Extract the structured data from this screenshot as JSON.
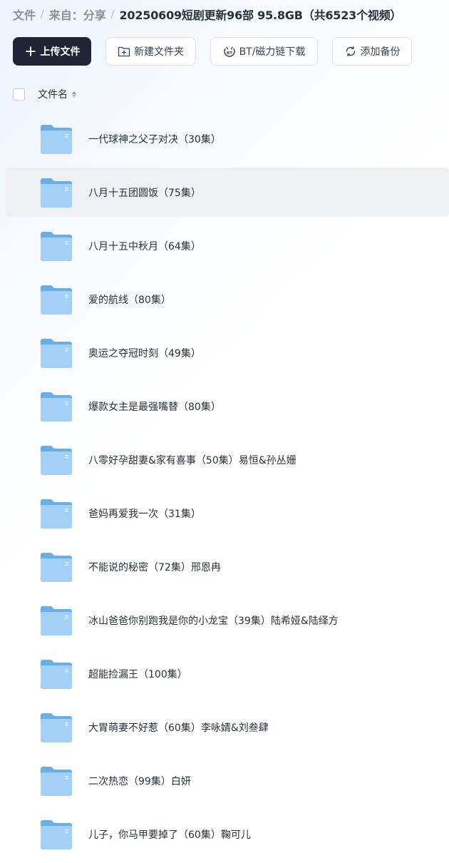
{
  "breadcrumb": {
    "root": "文件",
    "from": "来自：分享",
    "current": "20250609短剧更新96部 95.8GB（共6523个视频）"
  },
  "toolbar": {
    "upload_label": "上传文件",
    "new_folder_label": "新建文件夹",
    "bt_label": "BT/磁力链下载",
    "backup_label": "添加备份"
  },
  "list_header": {
    "name_col": "文件名"
  },
  "files": [
    {
      "name": "一代球神之父子对决（30集）"
    },
    {
      "name": "八月十五团圆饭（75集）"
    },
    {
      "name": "八月十五中秋月（64集）"
    },
    {
      "name": "爱的航线（80集）"
    },
    {
      "name": "奥运之夺冠时刻（49集）"
    },
    {
      "name": "爆款女主是最强嘴替（80集）"
    },
    {
      "name": "八零好孕甜妻&家有喜事（50集）易恒&孙丛姗"
    },
    {
      "name": "爸妈再爱我一次（31集）"
    },
    {
      "name": "不能说的秘密（72集）邢恩冉"
    },
    {
      "name": "冰山爸爸你别跑我是你的小龙宝（39集）陆希娅&陆绎方"
    },
    {
      "name": "超能捡漏王（100集）"
    },
    {
      "name": "大胃萌妻不好惹（60集）李咏婧&刘叁肆"
    },
    {
      "name": "二次热恋（99集）白妍"
    },
    {
      "name": "儿子，你马甲要掉了（60集）鞠可儿"
    }
  ],
  "colors": {
    "primary_button": "#1f2535",
    "folder_back": "#6aaee8",
    "folder_front": "#9fcdf5",
    "hover_row": "#eef0f3"
  }
}
